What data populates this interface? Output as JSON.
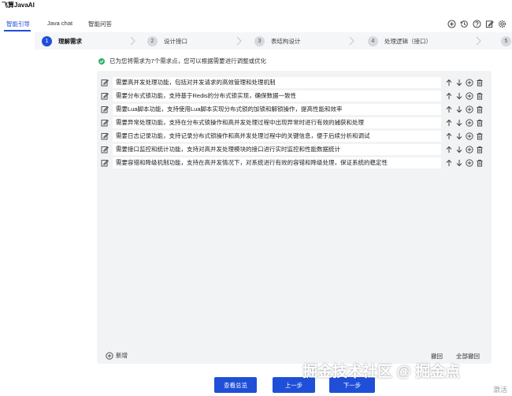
{
  "app": {
    "title": "飞算JavaAI"
  },
  "tabs": [
    {
      "label": "智能引导",
      "active": true
    },
    {
      "label": "Java chat",
      "active": false
    },
    {
      "label": "智能问答",
      "active": false
    }
  ],
  "steps": [
    {
      "number": "1",
      "label": "理解需求",
      "active": true
    },
    {
      "number": "2",
      "label": "设计接口",
      "active": false
    },
    {
      "number": "3",
      "label": "表结构设计",
      "active": false
    },
    {
      "number": "4",
      "label": "处理逻辑（接口）",
      "active": false
    },
    {
      "number": "5",
      "label": "",
      "active": false
    }
  ],
  "notice": {
    "text": "已为您将需求为7个需求点，您可以根据需要进行调整或优化"
  },
  "requirements": [
    "需要高并发处理功能，包括对并发请求的高效管理和处理机制",
    "需要分布式锁功能，支持基于Redis的分布式锁实现，确保数据一致性",
    "需要Lua脚本功能，支持使用Lua脚本实现分布式锁的加锁和解锁操作，提高性能和效率",
    "需要异常处理功能，支持在分布式锁操作和高并发处理过程中出现异常时进行有效的捕获和处理",
    "需要日志记录功能，支持记录分布式锁操作和高并发处理过程中的关键信息，便于后续分析和调试",
    "需要接口监控和统计功能，支持对高并发处理模块的接口进行实时监控和性能数据统计",
    "需要容错和降级机制功能，支持在高并发情况下，对系统进行有效的容错和降级处理，保证系统的稳定性"
  ],
  "panel": {
    "add_label": "新增",
    "undo_label": "撤回",
    "undo_all_label": "全部撤回"
  },
  "buttons": {
    "view_summary": "查看总览",
    "prev": "上一步",
    "next": "下一步"
  },
  "watermark": {
    "text": "掘金技术社区 @ 掘金点"
  },
  "activate": {
    "text": "激活"
  },
  "colors": {
    "accent": "#1f4fd8",
    "success": "#2fb36b",
    "panel_bg": "#f2f3f5"
  }
}
